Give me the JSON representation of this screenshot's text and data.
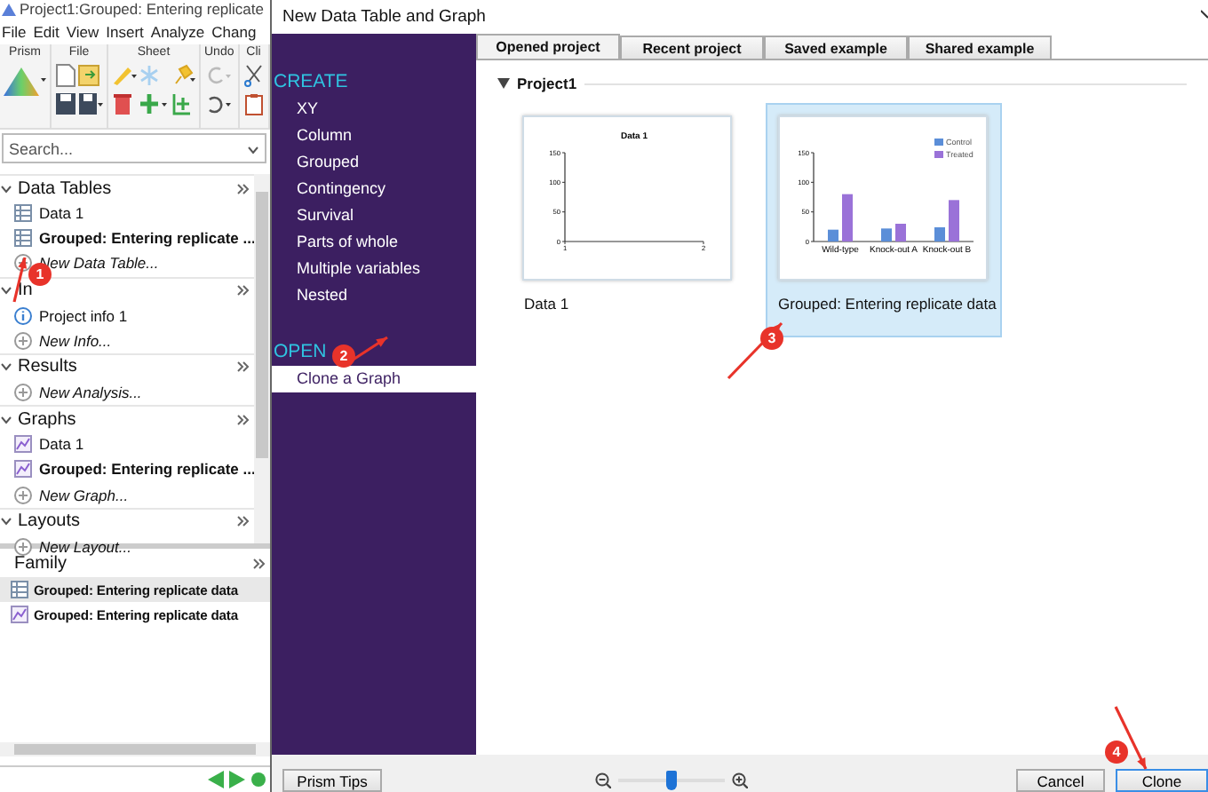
{
  "app": {
    "title": "Project1:Grouped: Entering replicate",
    "menu": [
      "File",
      "Edit",
      "View",
      "Insert",
      "Analyze",
      "Chang"
    ],
    "toolbar_groups": [
      {
        "label": "Prism"
      },
      {
        "label": "File"
      },
      {
        "label": "Sheet"
      },
      {
        "label": "Undo"
      },
      {
        "label": "Cli"
      }
    ],
    "search": {
      "placeholder": "Search..."
    },
    "navigator": [
      {
        "title": "Data Tables",
        "expanded": true,
        "items": [
          {
            "kind": "table",
            "label": "Data 1",
            "current": false
          },
          {
            "kind": "table",
            "label": "Grouped: Entering replicate ...",
            "current": true
          },
          {
            "kind": "new",
            "label": "New Data Table...",
            "current": false
          }
        ]
      },
      {
        "title": "In",
        "expanded": true,
        "items": [
          {
            "kind": "info",
            "label": "Project info 1",
            "current": false
          },
          {
            "kind": "new",
            "label": "New Info...",
            "current": false
          }
        ]
      },
      {
        "title": "Results",
        "expanded": true,
        "items": [
          {
            "kind": "new",
            "label": "New Analysis...",
            "current": false
          }
        ]
      },
      {
        "title": "Graphs",
        "expanded": true,
        "items": [
          {
            "kind": "graph",
            "label": "Data 1",
            "current": false
          },
          {
            "kind": "graph",
            "label": "Grouped: Entering replicate ...",
            "current": true
          },
          {
            "kind": "new",
            "label": "New Graph...",
            "current": false
          }
        ]
      },
      {
        "title": "Layouts",
        "expanded": true,
        "items": [
          {
            "kind": "new",
            "label": "New Layout...",
            "current": false
          }
        ]
      }
    ],
    "family": {
      "title": "Family",
      "items": [
        {
          "kind": "table",
          "label": "Grouped: Entering replicate data",
          "selected": true
        },
        {
          "kind": "graph",
          "label": "Grouped: Entering replicate data",
          "selected": false
        }
      ]
    }
  },
  "dialog": {
    "title": "New Data Table and Graph",
    "sections": [
      {
        "title": "CREATE",
        "items": [
          {
            "label": "XY",
            "selected": false
          },
          {
            "label": "Column",
            "selected": false
          },
          {
            "label": "Grouped",
            "selected": false
          },
          {
            "label": "Contingency",
            "selected": false
          },
          {
            "label": "Survival",
            "selected": false
          },
          {
            "label": "Parts of whole",
            "selected": false
          },
          {
            "label": "Multiple variables",
            "selected": false
          },
          {
            "label": "Nested",
            "selected": false
          }
        ]
      },
      {
        "title": "OPEN",
        "items": [
          {
            "label": "Clone a Graph",
            "selected": true
          }
        ]
      }
    ],
    "tabs": [
      {
        "label": "Opened project",
        "selected": true
      },
      {
        "label": "Recent project",
        "selected": false
      },
      {
        "label": "Saved example",
        "selected": false
      },
      {
        "label": "Shared example",
        "selected": false
      }
    ],
    "project": {
      "title": "Project1",
      "expanded": true,
      "graphs": [
        {
          "label": "Data 1",
          "selected": false,
          "chart_data": {
            "type": "scatter",
            "title": "Data 1",
            "xlim": [
              1,
              2
            ],
            "ylim": [
              0,
              150
            ],
            "xticks": [
              {
                "value": 1,
                "label": "1"
              },
              {
                "value": 2,
                "label": "2"
              }
            ],
            "yticks": [
              0,
              50,
              100,
              150
            ]
          }
        },
        {
          "label": "Grouped: Entering replicate data",
          "selected": true,
          "chart_data": {
            "type": "bar",
            "legend": true,
            "categories": [
              "Wild-type",
              "Knock-out A",
              "Knock-out B"
            ],
            "ylim": [
              0,
              150
            ],
            "yticks": [
              0,
              50,
              100,
              150
            ],
            "series": [
              {
                "name": "Control",
                "color": "#5b8ed8",
                "values": [
                  20,
                  22,
                  24
                ]
              },
              {
                "name": "Treated",
                "color": "#9a72d8",
                "values": [
                  80,
                  30,
                  70
                ]
              }
            ]
          }
        }
      ]
    },
    "zoom": {
      "level": 0.5
    },
    "buttons": [
      {
        "kind": "tips",
        "label": "Prism Tips",
        "default": false
      },
      {
        "kind": "cancel",
        "label": "Cancel",
        "default": false
      },
      {
        "kind": "clone",
        "label": "Clone",
        "default": true
      }
    ]
  },
  "annotations": [
    {
      "label": "1"
    },
    {
      "label": "2"
    },
    {
      "label": "3"
    },
    {
      "label": "4"
    }
  ]
}
